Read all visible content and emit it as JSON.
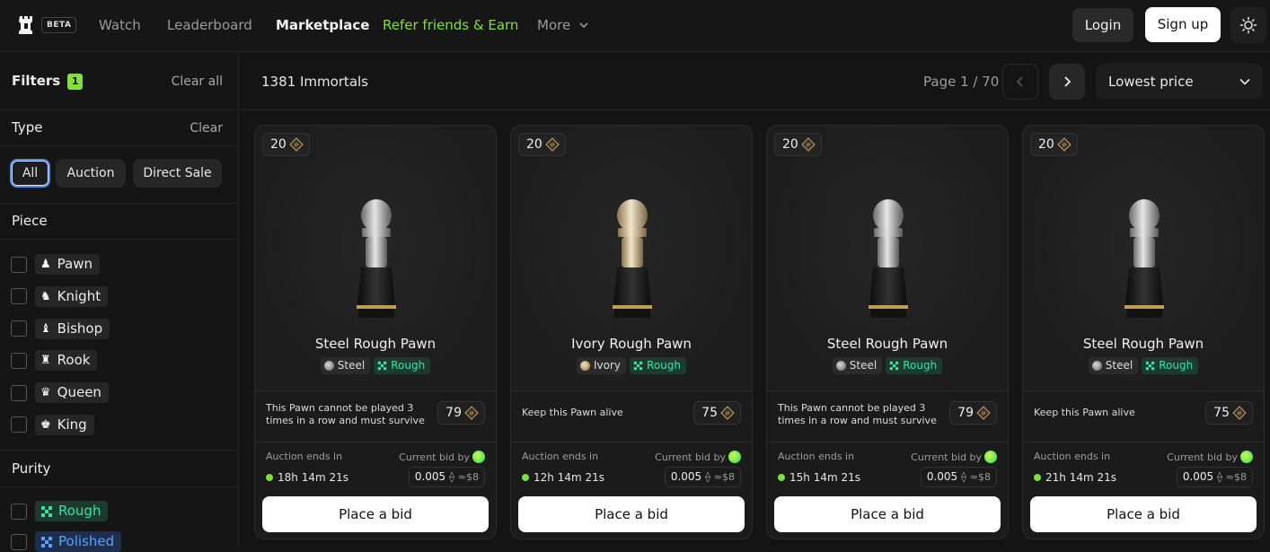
{
  "header": {
    "beta": "BETA",
    "nav": [
      "Watch",
      "Leaderboard",
      "Marketplace",
      "Refer friends & Earn",
      "More"
    ],
    "login": "Login",
    "signup": "Sign up"
  },
  "sidebar": {
    "filters_title": "Filters",
    "filters_count": "1",
    "clear_all": "Clear all",
    "type_title": "Type",
    "type_clear": "Clear",
    "type_options": [
      "All",
      "Auction",
      "Direct Sale"
    ],
    "piece_title": "Piece",
    "pieces": [
      {
        "label": "Pawn",
        "glyph": "♟"
      },
      {
        "label": "Knight",
        "glyph": "♞"
      },
      {
        "label": "Bishop",
        "glyph": "♝"
      },
      {
        "label": "Rook",
        "glyph": "♜"
      },
      {
        "label": "Queen",
        "glyph": "♛"
      },
      {
        "label": "King",
        "glyph": "♚"
      }
    ],
    "purity_title": "Purity",
    "purities": [
      {
        "label": "Rough",
        "color": "#3ee0a0",
        "bg": "#1d3a30"
      },
      {
        "label": "Polished",
        "color": "#5aa0ff",
        "bg": "#1d2f4d"
      }
    ]
  },
  "toolbar": {
    "count": "1381 Immortals",
    "page": "Page 1 / 70",
    "sort": "Lowest price"
  },
  "cards": [
    {
      "ip": "20",
      "name": "Steel Rough Pawn",
      "material": "Steel",
      "purity": "Rough",
      "rule": "This Pawn cannot be played 3 times in a row and must survive",
      "points": "79",
      "auction_label": "Auction ends in",
      "time": "18h 14m 21s",
      "bid_label": "Current bid by",
      "price": "0.005",
      "usd": "≈$8",
      "button": "Place a bid"
    },
    {
      "ip": "20",
      "name": "Ivory Rough Pawn",
      "material": "Ivory",
      "purity": "Rough",
      "rule": "Keep this Pawn alive",
      "points": "75",
      "auction_label": "Auction ends in",
      "time": "12h 14m 21s",
      "bid_label": "Current bid by",
      "price": "0.005",
      "usd": "≈$8",
      "button": "Place a bid"
    },
    {
      "ip": "20",
      "name": "Steel Rough Pawn",
      "material": "Steel",
      "purity": "Rough",
      "rule": "This Pawn cannot be played 3 times in a row and must survive",
      "points": "79",
      "auction_label": "Auction ends in",
      "time": "15h 14m 21s",
      "bid_label": "Current bid by",
      "price": "0.005",
      "usd": "≈$8",
      "button": "Place a bid"
    },
    {
      "ip": "20",
      "name": "Steel Rough Pawn",
      "material": "Steel",
      "purity": "Rough",
      "rule": "Keep this Pawn alive",
      "points": "75",
      "auction_label": "Auction ends in",
      "time": "21h 14m 21s",
      "bid_label": "Current bid by",
      "price": "0.005",
      "usd": "≈$8",
      "button": "Place a bid"
    }
  ],
  "colors": {
    "accent": "#7fe03a",
    "rough": "#3ee0a0",
    "polished": "#5aa0ff",
    "selected_border": "#4d8ef5"
  }
}
